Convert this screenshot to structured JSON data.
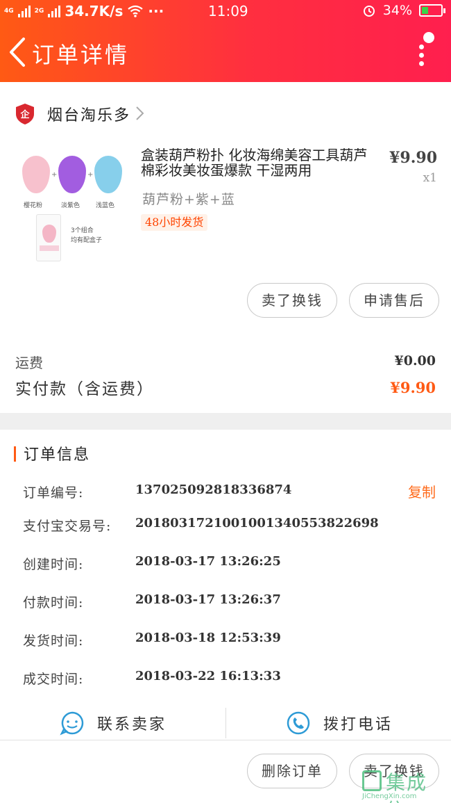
{
  "status_bar": {
    "net1": "4G",
    "net2": "2G",
    "speed": "34.7K/s",
    "more": "···",
    "time": "11:09",
    "battery": "34%",
    "battery_level": 0.34
  },
  "header": {
    "title": "订单详情"
  },
  "shop": {
    "name": "烟台淘乐多"
  },
  "product": {
    "title": "盒装葫芦粉扑 化妆海绵美容工具葫芦棉彩妆美妆蛋爆款 干湿两用",
    "price": "¥9.90",
    "qty": "x1",
    "spec": "葫芦粉+紫+蓝",
    "tag": "48小时发货",
    "thumb": {
      "labels": [
        "樱花粉",
        "淡紫色",
        "浅蓝色"
      ],
      "pack_note_1": "3个组合",
      "pack_note_2": "均有配盒子",
      "plus": "+"
    },
    "buttons": {
      "sell": "卖了换钱",
      "aftersale": "申请售后"
    }
  },
  "totals": {
    "shipping_label": "运费",
    "shipping_value": "¥0.00",
    "paid_label": "实付款（含运费）",
    "paid_value": "¥9.90"
  },
  "order_info": {
    "section_title": "订单信息",
    "copy_label": "复制",
    "rows": [
      {
        "label": "订单编号:",
        "value": "137025092818336874"
      },
      {
        "label": "支付宝交易号:",
        "value": "2018031721001001340553822698"
      },
      {
        "label": "创建时间:",
        "value": "2018-03-17 13:26:25"
      },
      {
        "label": "付款时间:",
        "value": "2018-03-17 13:26:37"
      },
      {
        "label": "发货时间:",
        "value": "2018-03-18 12:53:39"
      },
      {
        "label": "成交时间:",
        "value": "2018-03-22 16:13:33"
      }
    ]
  },
  "contact": {
    "seller": "联系卖家",
    "phone": "拨打电话"
  },
  "bottom": {
    "delete": "删除订单",
    "sell": "卖了换钱"
  },
  "watermark": {
    "text": "集成信",
    "url": "JiChengXin.com"
  },
  "colors": {
    "accent": "#ff5a14",
    "header_end": "#ff1f4e",
    "contact_icon": "#2e9bd6"
  }
}
